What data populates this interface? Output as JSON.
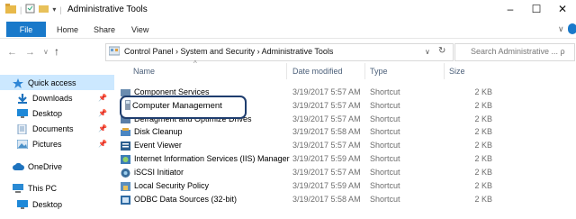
{
  "window": {
    "title": "Administrative Tools",
    "controls": {
      "minimize": "–",
      "maximize": "☐",
      "close": "✕"
    }
  },
  "ribbon": {
    "tabs": [
      "File",
      "Home",
      "Share",
      "View"
    ],
    "expand": "∨"
  },
  "address": {
    "back": "←",
    "forward": "→",
    "recent": "∨",
    "up": "↑",
    "crumbs": "Control Panel  ›  System and Security  ›  Administrative Tools",
    "dropdown": "∨",
    "refresh": "↻",
    "search_placeholder": "Search Administrative ... ρ"
  },
  "nav": {
    "items": [
      {
        "label": "Quick access",
        "icon": "star-icon",
        "color": "#2f86d6"
      },
      {
        "label": "Downloads",
        "icon": "download-icon",
        "color": "#1e73be",
        "pinned": "📌"
      },
      {
        "label": "Desktop",
        "icon": "desktop-icon",
        "color": "#1e88d8",
        "pinned": "📌"
      },
      {
        "label": "Documents",
        "icon": "documents-icon",
        "color": "#7a9fc4",
        "pinned": "📌"
      },
      {
        "label": "Pictures",
        "icon": "pictures-icon",
        "color": "#4a90c8",
        "pinned": "📌"
      },
      {
        "label": "OneDrive",
        "icon": "cloud-icon",
        "color": "#1e73be"
      },
      {
        "label": "This PC",
        "icon": "computer-icon",
        "color": "#2a8ad4"
      },
      {
        "label": "Desktop",
        "icon": "desktop-icon",
        "color": "#1e88d8"
      }
    ]
  },
  "columns": {
    "name": "Name",
    "date": "Date modified",
    "type": "Type",
    "size": "Size"
  },
  "files": [
    {
      "name": "Component Services",
      "date": "3/19/2017 5:57 AM",
      "type": "Shortcut",
      "size": "2 KB",
      "color": "#6a8caf"
    },
    {
      "name": "Computer Management",
      "date": "3/19/2017 5:57 AM",
      "type": "Shortcut",
      "size": "2 KB",
      "color": "#8a9bb0"
    },
    {
      "name": "Defragment and Optimize Drives",
      "date": "3/19/2017 5:57 AM",
      "type": "Shortcut",
      "size": "2 KB",
      "color": "#5a7fa8"
    },
    {
      "name": "Disk Cleanup",
      "date": "3/19/2017 5:58 AM",
      "type": "Shortcut",
      "size": "2 KB",
      "color": "#4b86c2"
    },
    {
      "name": "Event Viewer",
      "date": "3/19/2017 5:57 AM",
      "type": "Shortcut",
      "size": "2 KB",
      "color": "#2d5f8f"
    },
    {
      "name": "Internet Information Services (IIS) Manager",
      "date": "3/19/2017 5:59 AM",
      "type": "Shortcut",
      "size": "2 KB",
      "color": "#3c7db8"
    },
    {
      "name": "iSCSI Initiator",
      "date": "3/19/2017 5:57 AM",
      "type": "Shortcut",
      "size": "2 KB",
      "color": "#3a6e9c"
    },
    {
      "name": "Local Security Policy",
      "date": "3/19/2017 5:59 AM",
      "type": "Shortcut",
      "size": "2 KB",
      "color": "#5b8fbf"
    },
    {
      "name": "ODBC Data Sources (32-bit)",
      "date": "3/19/2017 5:58 AM",
      "type": "Shortcut",
      "size": "2 KB",
      "color": "#2e6aa3"
    }
  ],
  "highlight": {
    "label": "Computer Management"
  }
}
